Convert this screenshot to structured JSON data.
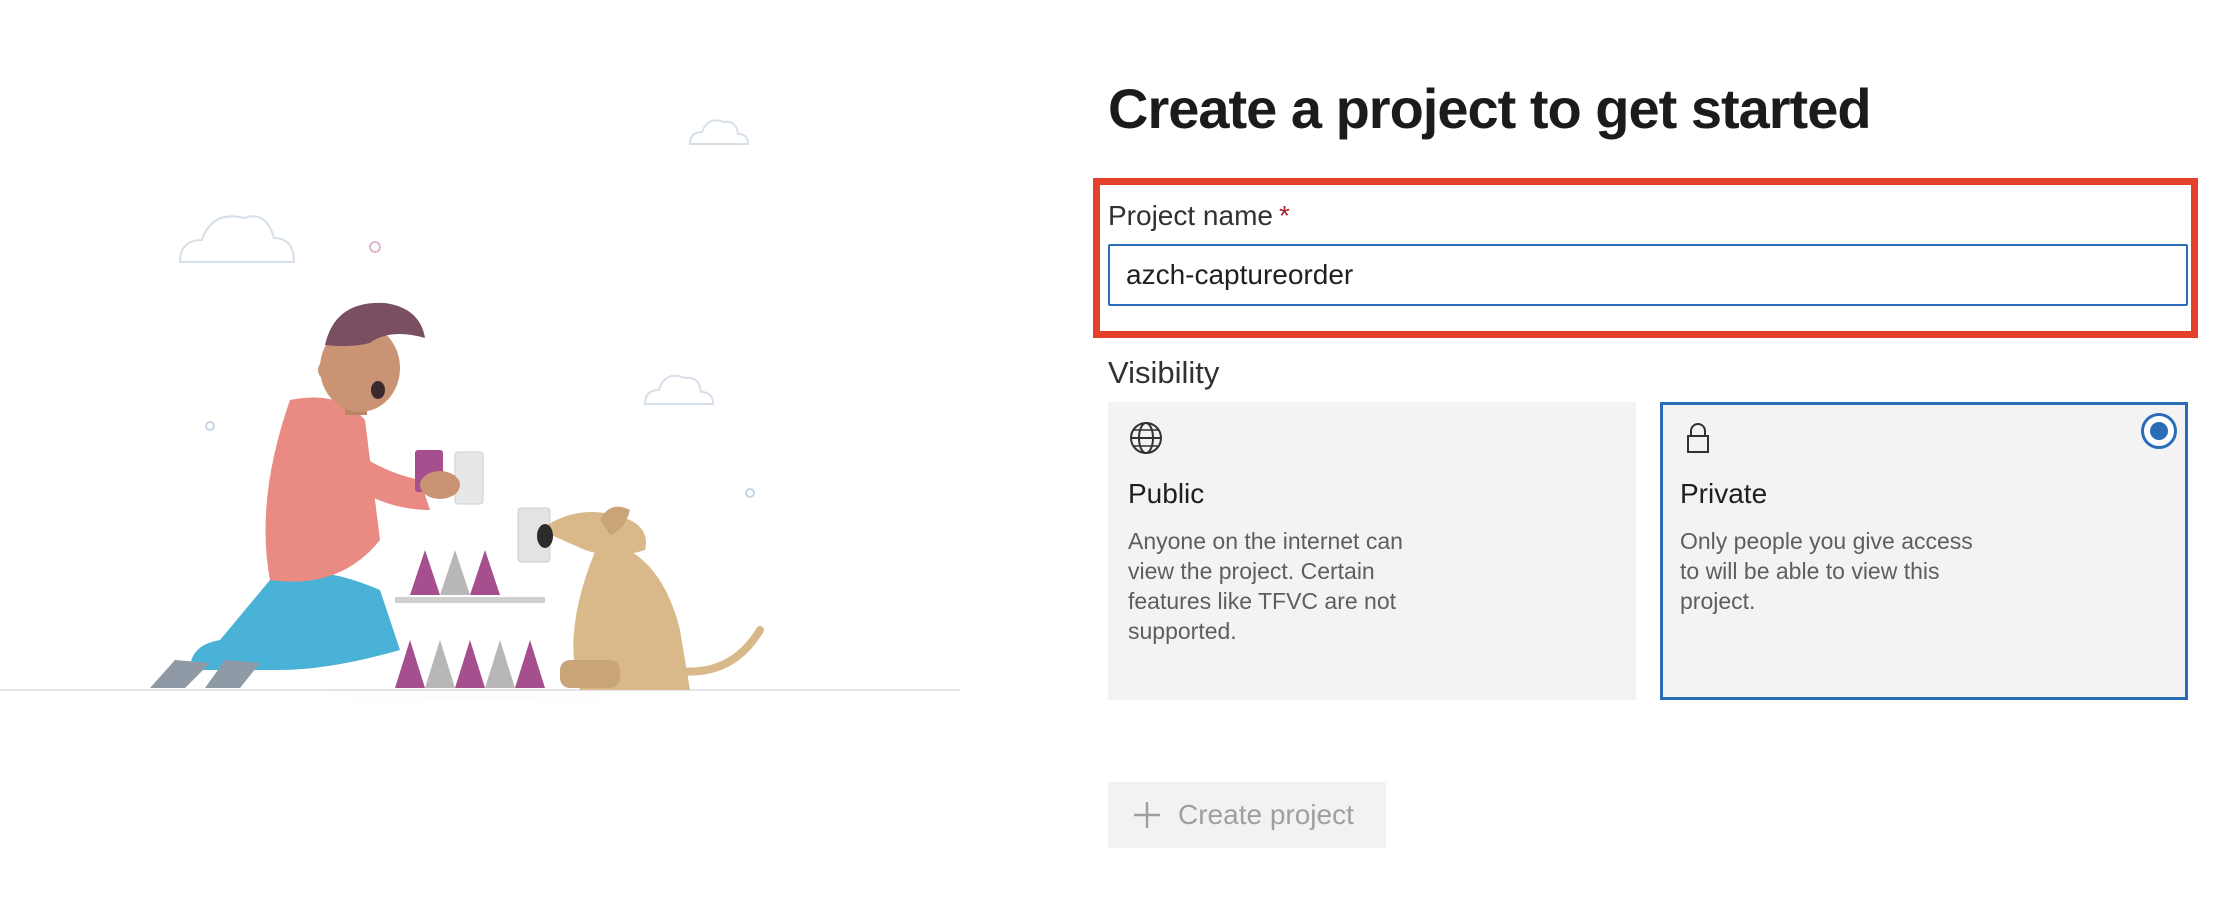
{
  "page": {
    "title": "Create a project to get started"
  },
  "project_name": {
    "label": "Project name",
    "required_marker": "*",
    "value": "azch-captureorder"
  },
  "visibility": {
    "label": "Visibility",
    "options": [
      {
        "title": "Public",
        "icon": "globe-icon",
        "description": "Anyone on the internet can view the project. Certain features like TFVC are not supported.",
        "selected": false
      },
      {
        "title": "Private",
        "icon": "lock-icon",
        "description": "Only people you give access to will be able to view this project.",
        "selected": true
      }
    ]
  },
  "actions": {
    "create_label": "Create project",
    "create_icon": "plus-icon",
    "create_disabled": true
  },
  "colors": {
    "accent": "#2b6cb8",
    "highlight": "#e5402b",
    "required": "#a4262c",
    "card_bg": "#f3f3f3"
  }
}
